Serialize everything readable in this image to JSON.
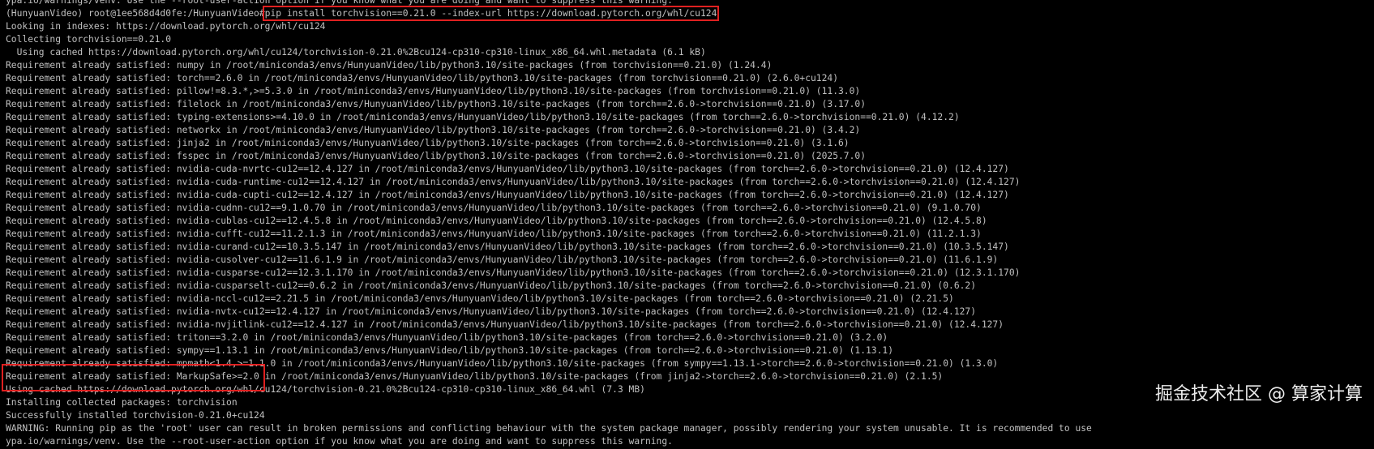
{
  "terminal": {
    "lines": [
      "ypa.io/warnings/venv. Use the --root-user-action option if you know what you are doing and want to suppress this warning.",
      "(HunyuanVideo) root@1ee568d4d0fe:/HunyuanVideo#",
      "Looking in indexes: https://download.pytorch.org/whl/cu124",
      "Collecting torchvision==0.21.0",
      "  Using cached https://download.pytorch.org/whl/cu124/torchvision-0.21.0%2Bcu124-cp310-cp310-linux_x86_64.whl.metadata (6.1 kB)",
      "Requirement already satisfied: numpy in /root/miniconda3/envs/HunyuanVideo/lib/python3.10/site-packages (from torchvision==0.21.0) (1.24.4)",
      "Requirement already satisfied: torch==2.6.0 in /root/miniconda3/envs/HunyuanVideo/lib/python3.10/site-packages (from torchvision==0.21.0) (2.6.0+cu124)",
      "Requirement already satisfied: pillow!=8.3.*,>=5.3.0 in /root/miniconda3/envs/HunyuanVideo/lib/python3.10/site-packages (from torchvision==0.21.0) (11.3.0)",
      "Requirement already satisfied: filelock in /root/miniconda3/envs/HunyuanVideo/lib/python3.10/site-packages (from torch==2.6.0->torchvision==0.21.0) (3.17.0)",
      "Requirement already satisfied: typing-extensions>=4.10.0 in /root/miniconda3/envs/HunyuanVideo/lib/python3.10/site-packages (from torch==2.6.0->torchvision==0.21.0) (4.12.2)",
      "Requirement already satisfied: networkx in /root/miniconda3/envs/HunyuanVideo/lib/python3.10/site-packages (from torch==2.6.0->torchvision==0.21.0) (3.4.2)",
      "Requirement already satisfied: jinja2 in /root/miniconda3/envs/HunyuanVideo/lib/python3.10/site-packages (from torch==2.6.0->torchvision==0.21.0) (3.1.6)",
      "Requirement already satisfied: fsspec in /root/miniconda3/envs/HunyuanVideo/lib/python3.10/site-packages (from torch==2.6.0->torchvision==0.21.0) (2025.7.0)",
      "Requirement already satisfied: nvidia-cuda-nvrtc-cu12==12.4.127 in /root/miniconda3/envs/HunyuanVideo/lib/python3.10/site-packages (from torch==2.6.0->torchvision==0.21.0) (12.4.127)",
      "Requirement already satisfied: nvidia-cuda-runtime-cu12==12.4.127 in /root/miniconda3/envs/HunyuanVideo/lib/python3.10/site-packages (from torch==2.6.0->torchvision==0.21.0) (12.4.127)",
      "Requirement already satisfied: nvidia-cuda-cupti-cu12==12.4.127 in /root/miniconda3/envs/HunyuanVideo/lib/python3.10/site-packages (from torch==2.6.0->torchvision==0.21.0) (12.4.127)",
      "Requirement already satisfied: nvidia-cudnn-cu12==9.1.0.70 in /root/miniconda3/envs/HunyuanVideo/lib/python3.10/site-packages (from torch==2.6.0->torchvision==0.21.0) (9.1.0.70)",
      "Requirement already satisfied: nvidia-cublas-cu12==12.4.5.8 in /root/miniconda3/envs/HunyuanVideo/lib/python3.10/site-packages (from torch==2.6.0->torchvision==0.21.0) (12.4.5.8)",
      "Requirement already satisfied: nvidia-cufft-cu12==11.2.1.3 in /root/miniconda3/envs/HunyuanVideo/lib/python3.10/site-packages (from torch==2.6.0->torchvision==0.21.0) (11.2.1.3)",
      "Requirement already satisfied: nvidia-curand-cu12==10.3.5.147 in /root/miniconda3/envs/HunyuanVideo/lib/python3.10/site-packages (from torch==2.6.0->torchvision==0.21.0) (10.3.5.147)",
      "Requirement already satisfied: nvidia-cusolver-cu12==11.6.1.9 in /root/miniconda3/envs/HunyuanVideo/lib/python3.10/site-packages (from torch==2.6.0->torchvision==0.21.0) (11.6.1.9)",
      "Requirement already satisfied: nvidia-cusparse-cu12==12.3.1.170 in /root/miniconda3/envs/HunyuanVideo/lib/python3.10/site-packages (from torch==2.6.0->torchvision==0.21.0) (12.3.1.170)",
      "Requirement already satisfied: nvidia-cusparselt-cu12==0.6.2 in /root/miniconda3/envs/HunyuanVideo/lib/python3.10/site-packages (from torch==2.6.0->torchvision==0.21.0) (0.6.2)",
      "Requirement already satisfied: nvidia-nccl-cu12==2.21.5 in /root/miniconda3/envs/HunyuanVideo/lib/python3.10/site-packages (from torch==2.6.0->torchvision==0.21.0) (2.21.5)",
      "Requirement already satisfied: nvidia-nvtx-cu12==12.4.127 in /root/miniconda3/envs/HunyuanVideo/lib/python3.10/site-packages (from torch==2.6.0->torchvision==0.21.0) (12.4.127)",
      "Requirement already satisfied: nvidia-nvjitlink-cu12==12.4.127 in /root/miniconda3/envs/HunyuanVideo/lib/python3.10/site-packages (from torch==2.6.0->torchvision==0.21.0) (12.4.127)",
      "Requirement already satisfied: triton==3.2.0 in /root/miniconda3/envs/HunyuanVideo/lib/python3.10/site-packages (from torch==2.6.0->torchvision==0.21.0) (3.2.0)",
      "Requirement already satisfied: sympy==1.13.1 in /root/miniconda3/envs/HunyuanVideo/lib/python3.10/site-packages (from torch==2.6.0->torchvision==0.21.0) (1.13.1)",
      "Requirement already satisfied: mpmath<1.4,>=1.1.0 in /root/miniconda3/envs/HunyuanVideo/lib/python3.10/site-packages (from sympy==1.13.1->torch==2.6.0->torchvision==0.21.0) (1.3.0)",
      "Requirement already satisfied: MarkupSafe>=2.0 in /root/miniconda3/envs/HunyuanVideo/lib/python3.10/site-packages (from jinja2->torch==2.6.0->torchvision==0.21.0) (2.1.5)",
      "Using cached https://download.pytorch.org/whl/cu124/torchvision-0.21.0%2Bcu124-cp310-cp310-linux_x86_64.whl (7.3 MB)",
      "Installing collected packages: torchvision",
      "Successfully installed torchvision-0.21.0+cu124",
      "WARNING: Running pip as the 'root' user can result in broken permissions and conflicting behaviour with the system package manager, possibly rendering your system unusable. It is recommended to use",
      "ypa.io/warnings/venv. Use the --root-user-action option if you know what you are doing and want to suppress this warning."
    ],
    "command": "pip install torchvision==0.21.0 --index-url https://download.pytorch.org/whl/cu124"
  },
  "watermark": "掘金技术社区 @ 算家计算",
  "colors": {
    "background": "#000000",
    "text": "#c0c0c0",
    "highlight": "#e02020"
  }
}
